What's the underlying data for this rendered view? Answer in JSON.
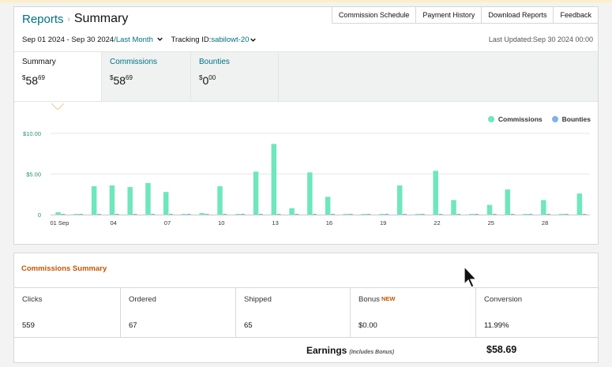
{
  "breadcrumb": {
    "root": "Reports",
    "separator": "›",
    "current": "Summary"
  },
  "top_nav": [
    "Commission Schedule",
    "Payment History",
    "Download Reports",
    "Feedback"
  ],
  "filters": {
    "date_range": "Sep 01 2024 - Sep 30 2024 ",
    "period_sep": "/",
    "period_link": "Last Month",
    "tracking_label": "Tracking ID:",
    "tracking_value": "sabilowt-20"
  },
  "last_updated": "Last Updated:Sep 30 2024 00:00",
  "tabs": [
    {
      "label": "Summary",
      "currency": "$",
      "whole": "58",
      "cents": "69"
    },
    {
      "label": "Commissions",
      "currency": "$",
      "whole": "58",
      "cents": "69"
    },
    {
      "label": "Bounties",
      "currency": "$",
      "whole": "0",
      "cents": "00"
    }
  ],
  "colors": {
    "commissions": "#6ee7bc",
    "bounties": "#7fb2e8",
    "accent_link": "#007185",
    "orange": "#c45500"
  },
  "chart_data": {
    "type": "bar",
    "ylim": [
      0,
      10
    ],
    "ytick_values": [
      0,
      5,
      10
    ],
    "ytick_labels": [
      "0",
      "$5.00",
      "$10.00"
    ],
    "categories": [
      "01 Sep",
      "02",
      "03",
      "04",
      "05",
      "06",
      "07",
      "08",
      "09",
      "10",
      "11",
      "12",
      "13",
      "14",
      "15",
      "16",
      "17",
      "18",
      "19",
      "20",
      "21",
      "22",
      "23",
      "24",
      "25",
      "26",
      "27",
      "28",
      "29",
      "30"
    ],
    "xtick_labels": [
      {
        "index": 0,
        "label": "01 Sep"
      },
      {
        "index": 3,
        "label": "04"
      },
      {
        "index": 6,
        "label": "07"
      },
      {
        "index": 9,
        "label": "10"
      },
      {
        "index": 12,
        "label": "13"
      },
      {
        "index": 15,
        "label": "16"
      },
      {
        "index": 18,
        "label": "19"
      },
      {
        "index": 21,
        "label": "22"
      },
      {
        "index": 24,
        "label": "25"
      },
      {
        "index": 27,
        "label": "28"
      }
    ],
    "legend_position": "top-right",
    "series": [
      {
        "name": "Commissions",
        "values": [
          0.3,
          0.1,
          3.5,
          3.6,
          3.4,
          3.9,
          2.8,
          0.1,
          0.2,
          3.5,
          0.1,
          5.3,
          8.7,
          0.8,
          5.2,
          2.2,
          0.1,
          0.1,
          0.1,
          3.6,
          0.1,
          5.4,
          1.8,
          0.1,
          1.2,
          3.1,
          0.1,
          1.8,
          0.1,
          2.6
        ]
      },
      {
        "name": "Bounties",
        "values": [
          0.1,
          0.1,
          0.1,
          0.1,
          0.1,
          0.1,
          0.1,
          0.1,
          0.1,
          0.1,
          0.1,
          0.1,
          0.1,
          0.1,
          0.1,
          0.1,
          0.1,
          0.1,
          0.1,
          0.1,
          0.1,
          0.1,
          0.1,
          0.1,
          0.1,
          0.1,
          0.1,
          0.1,
          0.1,
          0.1
        ]
      }
    ]
  },
  "commissions_summary": {
    "title": "Commissions Summary",
    "columns": [
      {
        "label": "Clicks",
        "value": "559"
      },
      {
        "label": "Ordered",
        "value": "67"
      },
      {
        "label": "Shipped",
        "value": "65"
      },
      {
        "label": "Bonus",
        "badge": "NEW",
        "value": "$0.00"
      },
      {
        "label": "Conversion",
        "value": "11.99%"
      }
    ],
    "earnings_label": "Earnings",
    "earnings_note": "(Includes Bonus)",
    "earnings_value": "$58.69"
  }
}
